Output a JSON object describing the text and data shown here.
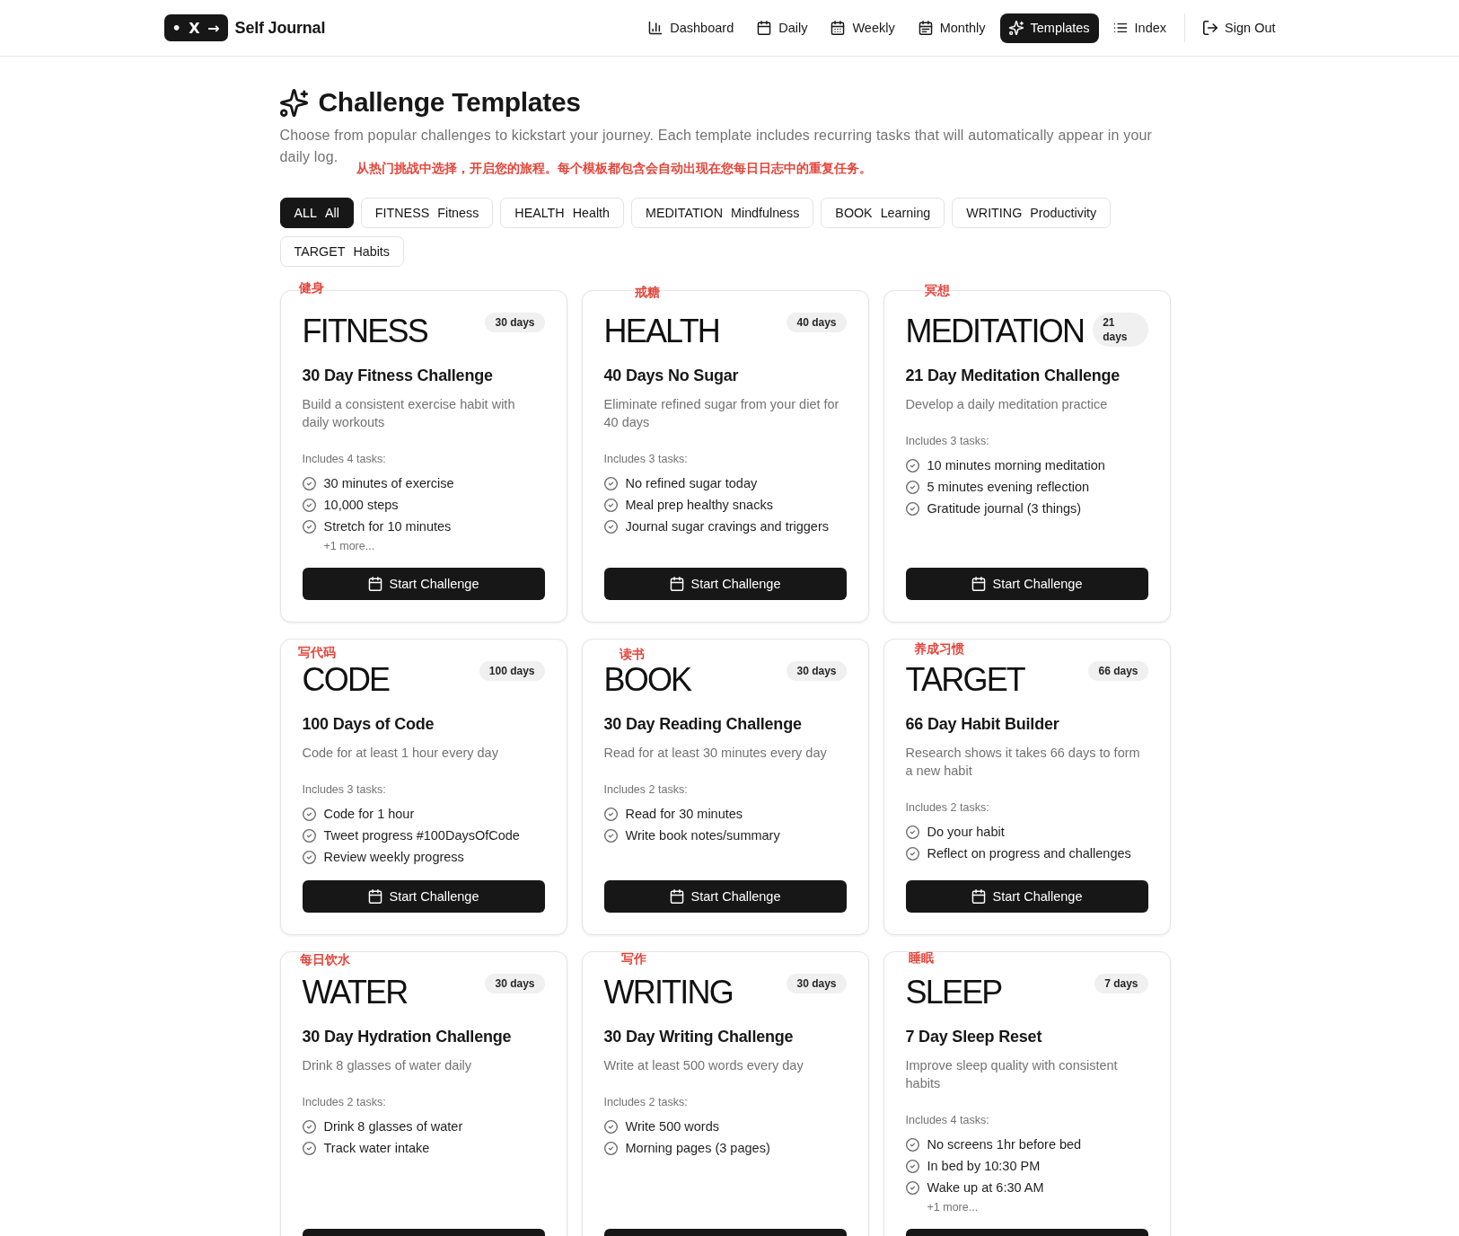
{
  "header": {
    "logo": {
      "mark": "• X →",
      "title": "Self Journal"
    },
    "nav": [
      {
        "label": "Dashboard",
        "selected": false
      },
      {
        "label": "Daily",
        "selected": false
      },
      {
        "label": "Weekly",
        "selected": false
      },
      {
        "label": "Monthly",
        "selected": false
      },
      {
        "label": "Templates",
        "selected": true
      },
      {
        "label": "Index",
        "selected": false
      }
    ],
    "sign_out": {
      "label": "Sign Out"
    }
  },
  "page": {
    "title": "Challenge Templates",
    "description": "Choose from popular challenges to kickstart your journey. Each template includes recurring tasks that will automatically appear in your daily log.",
    "description_note": "从热门挑战中选择，开启您的旅程。每个模板都包含会自动出现在您每日日志中的重复任务。"
  },
  "filters": [
    {
      "tag": "ALL",
      "label": "All",
      "selected": true
    },
    {
      "tag": "FITNESS",
      "label": "Fitness",
      "selected": false
    },
    {
      "tag": "HEALTH",
      "label": "Health",
      "selected": false
    },
    {
      "tag": "MEDITATION",
      "label": "Mindfulness",
      "selected": false
    },
    {
      "tag": "BOOK",
      "label": "Learning",
      "selected": false
    },
    {
      "tag": "WRITING",
      "label": "Productivity",
      "selected": false
    },
    {
      "tag": "TARGET",
      "label": "Habits",
      "selected": false
    }
  ],
  "cards": [
    {
      "note": "健身",
      "tag": "FITNESS",
      "duration": "30 days",
      "name": "30 Day Fitness Challenge",
      "description": "Build a consistent exercise habit with daily workouts",
      "tasks_heading": "Includes 4 tasks:",
      "tasks": [
        "30 minutes of exercise",
        "10,000 steps",
        "Stretch for 10 minutes"
      ],
      "more": "+1 more...",
      "button": "Start Challenge"
    },
    {
      "note": "戒糖",
      "tag": "HEALTH",
      "duration": "40 days",
      "name": "40 Days No Sugar",
      "description": "Eliminate refined sugar from your diet for 40 days",
      "tasks_heading": "Includes 3 tasks:",
      "tasks": [
        "No refined sugar today",
        "Meal prep healthy snacks",
        "Journal sugar cravings and triggers"
      ],
      "button": "Start Challenge"
    },
    {
      "note": "冥想",
      "tag": "MEDITATION",
      "duration": "21 days",
      "name": "21 Day Meditation Challenge",
      "description": "Develop a daily meditation practice",
      "tasks_heading": "Includes 3 tasks:",
      "tasks": [
        "10 minutes morning meditation",
        "5 minutes evening reflection",
        "Gratitude journal (3 things)"
      ],
      "button": "Start Challenge"
    },
    {
      "note": "写代码",
      "tag": "CODE",
      "duration": "100 days",
      "name": "100 Days of Code",
      "description": "Code for at least 1 hour every day",
      "tasks_heading": "Includes 3 tasks:",
      "tasks": [
        "Code for 1 hour",
        "Tweet progress #100DaysOfCode",
        "Review weekly progress"
      ],
      "button": "Start Challenge"
    },
    {
      "note": "读书",
      "tag": "BOOK",
      "duration": "30 days",
      "name": "30 Day Reading Challenge",
      "description": "Read for at least 30 minutes every day",
      "tasks_heading": "Includes 2 tasks:",
      "tasks": [
        "Read for 30 minutes",
        "Write book notes/summary"
      ],
      "button": "Start Challenge"
    },
    {
      "note": "养成习惯",
      "tag": "TARGET",
      "duration": "66 days",
      "name": "66 Day Habit Builder",
      "description": "Research shows it takes 66 days to form a new habit",
      "tasks_heading": "Includes 2 tasks:",
      "tasks": [
        "Do your habit",
        "Reflect on progress and challenges"
      ],
      "button": "Start Challenge"
    },
    {
      "note": "每日饮水",
      "tag": "WATER",
      "duration": "30 days",
      "name": "30 Day Hydration Challenge",
      "description": "Drink 8 glasses of water daily",
      "tasks_heading": "Includes 2 tasks:",
      "tasks": [
        "Drink 8 glasses of water",
        "Track water intake"
      ]
    },
    {
      "note": "写作",
      "tag": "WRITING",
      "duration": "30 days",
      "name": "30 Day Writing Challenge",
      "description": "Write at least 500 words every day",
      "tasks_heading": "Includes 2 tasks:",
      "tasks": [
        "Write 500 words",
        "Morning pages (3 pages)"
      ]
    },
    {
      "note": "睡眠",
      "tag": "SLEEP",
      "duration": "7 days",
      "name": "7 Day Sleep Reset",
      "description": "Improve sleep quality with consistent habits",
      "tasks_heading": "Includes 4 tasks:",
      "tasks": [
        "No screens 1hr before bed",
        "In bed by 10:30 PM",
        "Wake up at 6:30 AM"
      ],
      "more": "+1 more..."
    }
  ]
}
